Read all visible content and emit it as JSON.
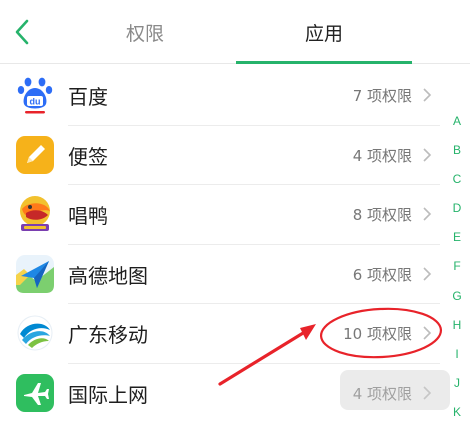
{
  "header": {
    "tabs": [
      {
        "label": "权限"
      },
      {
        "label": "应用"
      }
    ],
    "active_color": "#26b36b"
  },
  "apps": [
    {
      "name": "百度",
      "count": "7 项权限"
    },
    {
      "name": "便签",
      "count": "4 项权限"
    },
    {
      "name": "唱鸭",
      "count": "8 项权限"
    },
    {
      "name": "高德地图",
      "count": "6 项权限"
    },
    {
      "name": "广东移动",
      "count": "10 项权限"
    },
    {
      "name": "国际上网",
      "count": "4 项权限"
    }
  ],
  "alphabet": [
    "A",
    "B",
    "C",
    "D",
    "E",
    "F",
    "G",
    "H",
    "I",
    "J",
    "K"
  ],
  "annotation": {
    "color": "#e8232a"
  }
}
